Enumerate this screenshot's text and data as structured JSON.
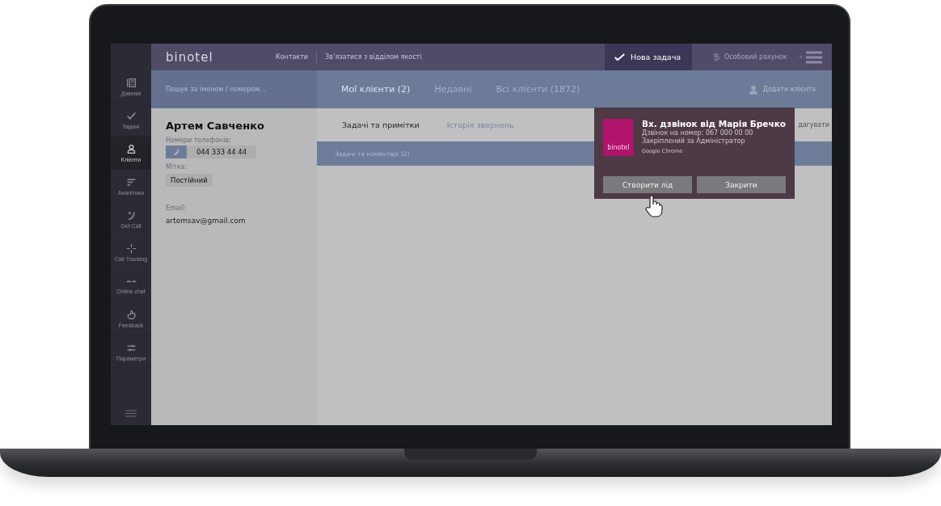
{
  "topbar": {
    "logo": "binotel",
    "links": [
      {
        "label": "Контакти"
      },
      {
        "label": "Зв’язатися з відділом якості"
      }
    ],
    "new_task": "Нова задача",
    "account": "Особовий рахунок"
  },
  "sidebar": {
    "items": [
      {
        "label": "Дзвінки",
        "selected": false
      },
      {
        "label": "Задачі",
        "selected": false
      },
      {
        "label": "Клієнти",
        "selected": true
      },
      {
        "label": "Аналітика",
        "selected": false
      },
      {
        "label": "Get Call",
        "selected": false
      },
      {
        "label": "Call Tracking",
        "selected": false
      },
      {
        "label": "Online chat",
        "selected": false
      },
      {
        "label": "Feedback",
        "selected": false
      },
      {
        "label": "Параметри",
        "selected": false
      }
    ]
  },
  "search": {
    "placeholder": "Пошук за іменем / номером..."
  },
  "client_tabs": [
    {
      "label": "Мої клієнти (2)",
      "selected": true
    },
    {
      "label": "Недавні",
      "selected": false
    },
    {
      "label": "Всі клієнти (1872)",
      "selected": false
    }
  ],
  "add_client": "Додати клієнта",
  "client": {
    "name": "Артем Савченко",
    "phones_label": "Номери телефонів:",
    "phone": "044 333 44 44",
    "tag_label": "Мітка:",
    "tag": "Постійний",
    "email_label": "Email:",
    "email": "artemsav@gmail.com"
  },
  "detail_tabs": [
    {
      "label": "Задачі та примітки",
      "selected": true
    },
    {
      "label": "Історія звернень",
      "selected": false
    }
  ],
  "edit_link": "дагувати",
  "tasks_header": "Задачі та коментарі (2)",
  "notification": {
    "logo": "binotel",
    "title": "Вх. дзвінок від Марія Бречко",
    "lines": [
      "Дзвінок на номер: 067 000 00 00",
      "Закріплений за Адміністратор"
    ],
    "source": "Google Chrome",
    "buttons": [
      "Створити лід",
      "Закрити"
    ]
  }
}
